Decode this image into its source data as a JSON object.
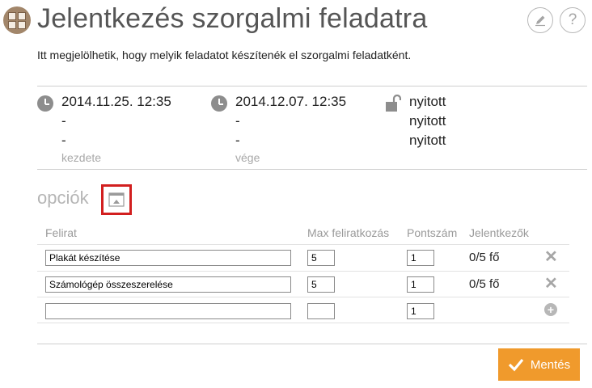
{
  "header": {
    "app_icon": "ab-grid-icon",
    "title": "Jelentkezés szorgalmi feladatra",
    "edit_icon": "pencil-icon",
    "help_label": "?",
    "subtitle": "Itt megjelölhetik, hogy melyik feladatot készítenék el szorgalmi feladatként."
  },
  "info": {
    "start": {
      "icon": "clock-icon",
      "lines": [
        "2014.11.25. 12:35",
        "-",
        "-"
      ],
      "label": "kezdete"
    },
    "end": {
      "icon": "clock-icon",
      "lines": [
        "2014.12.07. 12:35",
        "-",
        "-"
      ],
      "label": "vége"
    },
    "status": {
      "icon": "unlocked-padlock-icon",
      "lines": [
        "nyitott",
        "nyitott",
        "nyitott"
      ]
    }
  },
  "options": {
    "title": "opciók",
    "toggle_icon": "collapse-options-icon",
    "columns": [
      "Felirat",
      "Max feliratkozás",
      "Pontszám",
      "Jelentkezők"
    ],
    "rows": [
      {
        "label": "Plakát készítése",
        "max": "5",
        "points": "1",
        "count": "0/5 fő",
        "action_icon": "delete-x-icon"
      },
      {
        "label": "Számológép összeszerelése",
        "max": "5",
        "points": "1",
        "count": "0/5 fő",
        "action_icon": "delete-x-icon"
      },
      {
        "label": "",
        "max": "",
        "points": "1",
        "count": "",
        "action_icon": "add-circle-icon"
      }
    ]
  },
  "footer": {
    "save_label": "Mentés",
    "save_icon": "checkmark-icon"
  },
  "colors": {
    "accent": "#f09a2c",
    "highlight": "#d21f1f",
    "app_icon": "#a2866a"
  }
}
